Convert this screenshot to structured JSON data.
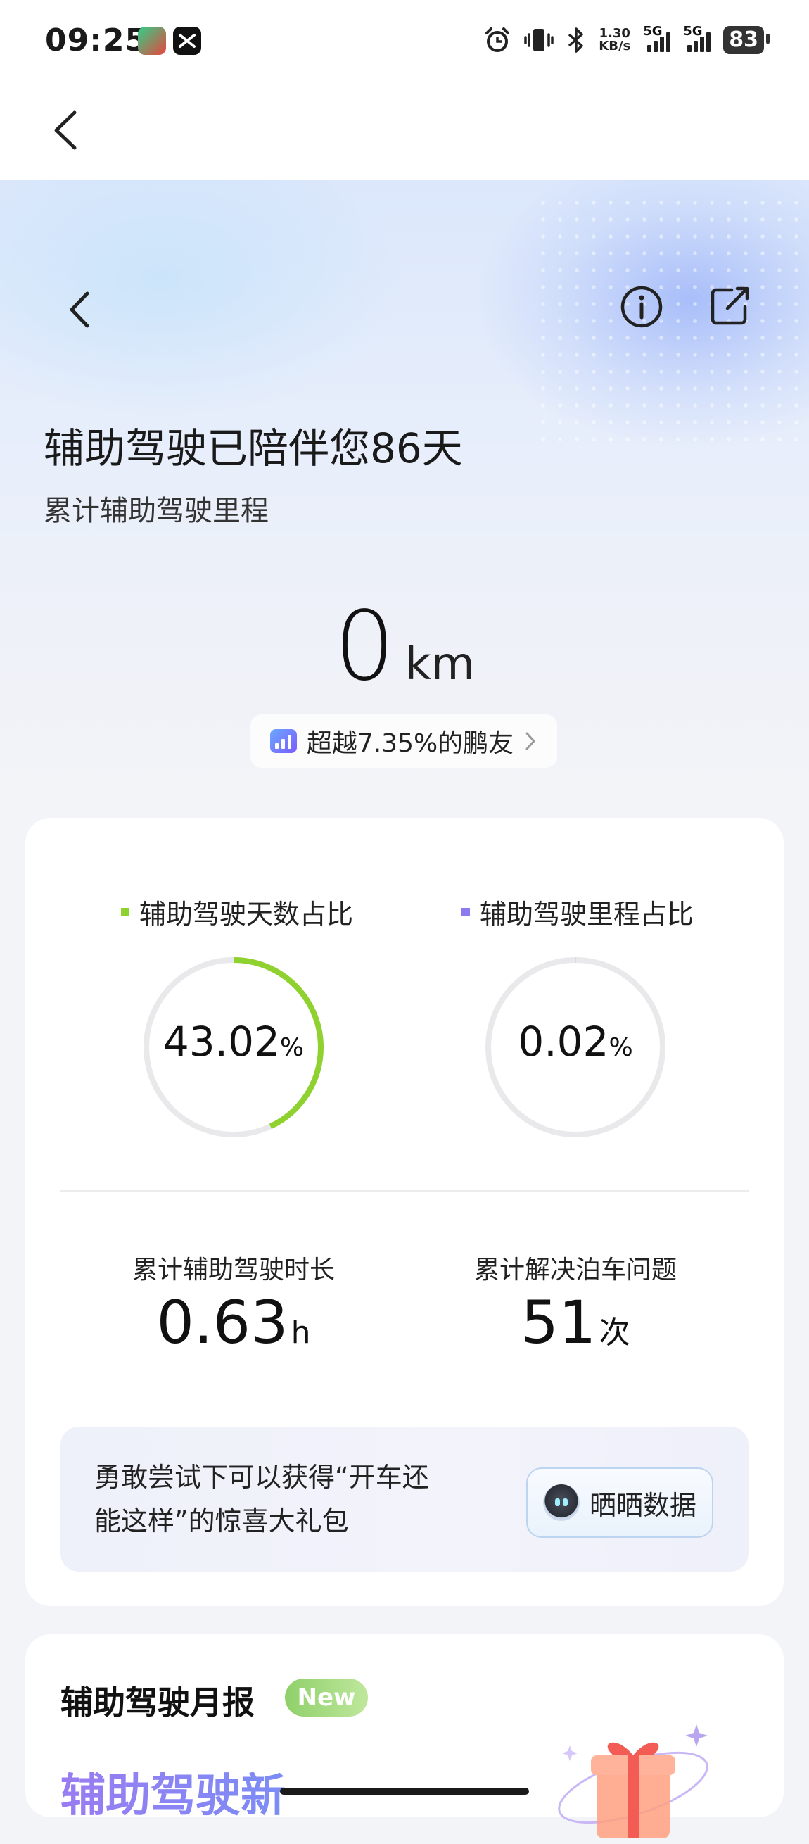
{
  "status_bar": {
    "time": "09:25",
    "net_speed_value": "1.30",
    "net_speed_unit": "KB/s",
    "signal1_label": "5G",
    "signal2_label": "5G",
    "battery": "83"
  },
  "hero": {
    "title": "辅助驾驶已陪伴您86天",
    "subtitle": "累计辅助驾驶里程",
    "distance_value": "0",
    "distance_unit": "km",
    "rank_text": "超越7.35%的鹏友"
  },
  "stats_card": {
    "legend_days": "辅助驾驶天数占比",
    "legend_mileage": "辅助驾驶里程占比",
    "days_ratio": {
      "value": "43.02",
      "unit": "%",
      "fraction": 0.4302,
      "color": "#8fd12e"
    },
    "mileage_ratio": {
      "value": "0.02",
      "unit": "%",
      "fraction": 0.0002,
      "color": "#8a7cf0"
    },
    "duration_label": "累计辅助驾驶时长",
    "duration_value": "0.63",
    "duration_unit": "h",
    "parking_label": "累计解决泊车问题",
    "parking_value": "51",
    "parking_unit": "次",
    "promo_line1": "勇敢尝试下可以获得“开车还",
    "promo_line2": "能这样”的惊喜大礼包",
    "share_button": "晒晒数据"
  },
  "monthly_card": {
    "title": "辅助驾驶月报",
    "badge": "New",
    "preview_text": "辅助驾驶新"
  }
}
